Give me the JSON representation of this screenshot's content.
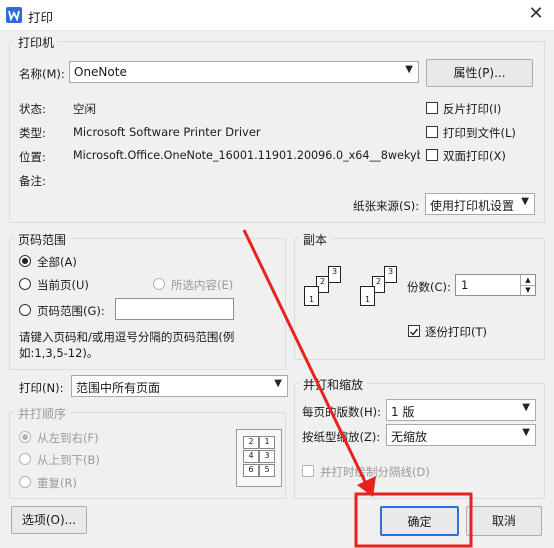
{
  "window": {
    "title": "打印",
    "close_glyph": "✕",
    "app_icon": "wps-writer-icon"
  },
  "printer": {
    "group_label": "打印机",
    "name_label": "名称(M):",
    "name_value": "OneNote",
    "properties_button": "属性(P)...",
    "status_label": "状态:",
    "status_value": "空闲",
    "type_label": "类型:",
    "type_value": "Microsoft Software Printer Driver",
    "location_label": "位置:",
    "location_value": "Microsoft.Office.OneNote_16001.11901.20096.0_x64__8wekyb",
    "comment_label": "备注:",
    "reverse_print": "反片打印(I)",
    "print_to_file": "打印到文件(L)",
    "duplex": "双面打印(X)",
    "paper_source_label": "纸张来源(S):",
    "paper_source_value": "使用打印机设置"
  },
  "page_range": {
    "group_label": "页码范围",
    "all": "全部(A)",
    "current": "当前页(U)",
    "selection": "所选内容(E)",
    "range": "页码范围(G):",
    "range_value": "",
    "hint": "请键入页码和/或用逗号分隔的页码范围(例如:1,3,5-12)。"
  },
  "print_what": {
    "label": "打印(N):",
    "value": "范围中所有页面"
  },
  "collate_order": {
    "group_label": "并打顺序",
    "left_to_right": "从左到右(F)",
    "top_to_bottom": "从上到下(B)",
    "repeat": "重复(R)",
    "grid_numbers": [
      "1",
      "2",
      "3",
      "4",
      "5",
      "6"
    ]
  },
  "copies": {
    "group_label": "副本",
    "count_label": "份数(C):",
    "count_value": "1",
    "collate": "逐份打印(T)",
    "stack_numbers": [
      "3",
      "2",
      "1"
    ]
  },
  "zoom": {
    "group_label": "并打和缩放",
    "pages_per_sheet_label": "每页的版数(H):",
    "pages_per_sheet_value": "1 版",
    "scale_label": "按纸型缩放(Z):",
    "scale_value": "无缩放",
    "divider": "并打时绘制分隔线(D)"
  },
  "buttons": {
    "options": "选项(O)...",
    "ok": "确定",
    "cancel": "取消"
  },
  "colors": {
    "annotation_red": "#e8221c",
    "ok_border": "#2a74d8"
  }
}
